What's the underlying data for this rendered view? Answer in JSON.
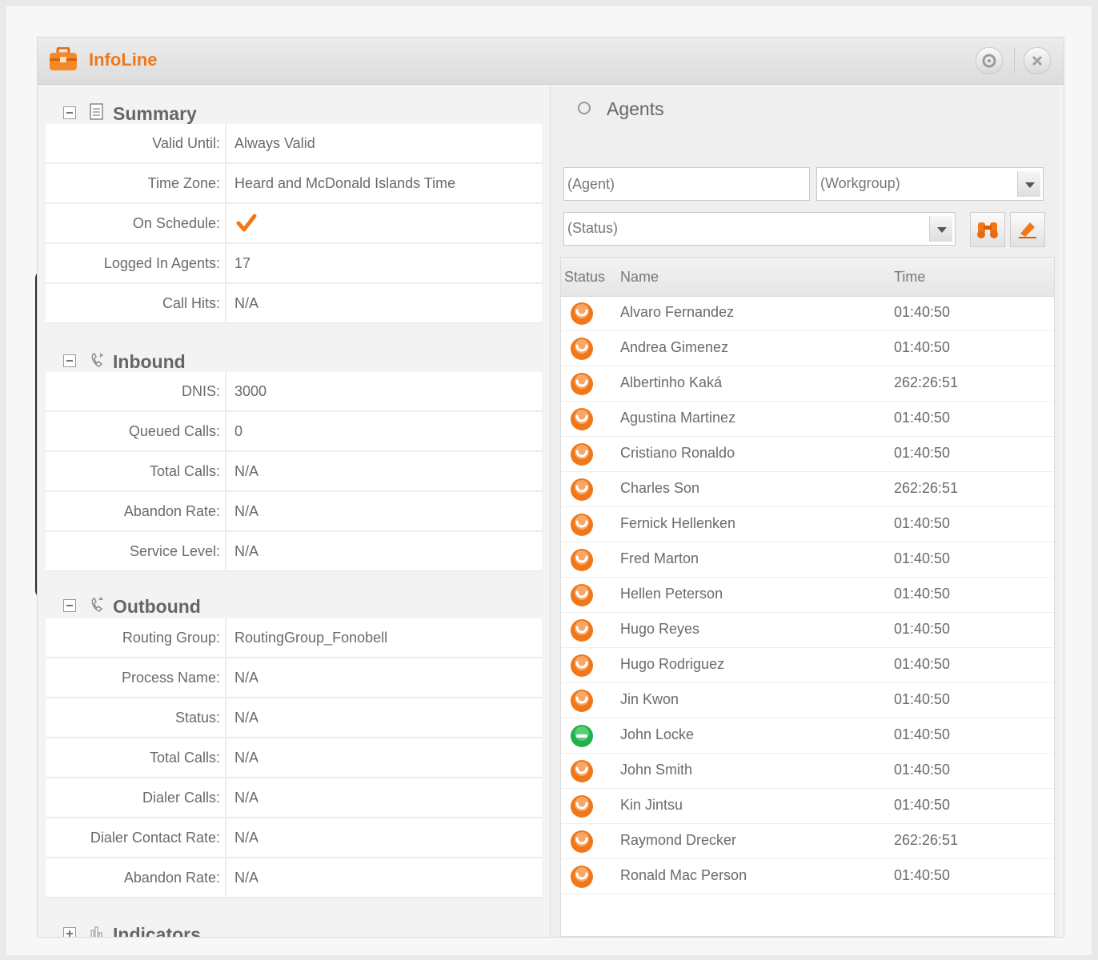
{
  "header": {
    "title": "InfoLine"
  },
  "summary": {
    "title": "Summary",
    "rows": [
      {
        "label": "Valid Until:",
        "value": "Always Valid"
      },
      {
        "label": "Time Zone:",
        "value": "Heard and McDonald Islands Time"
      },
      {
        "label": "On Schedule:",
        "value": ""
      },
      {
        "label": "Logged In Agents:",
        "value": "17"
      },
      {
        "label": "Call Hits:",
        "value": "N/A"
      }
    ]
  },
  "inbound": {
    "title": "Inbound",
    "rows": [
      {
        "label": "DNIS:",
        "value": "3000"
      },
      {
        "label": "Queued Calls:",
        "value": "0"
      },
      {
        "label": "Total Calls:",
        "value": "N/A"
      },
      {
        "label": "Abandon Rate:",
        "value": "N/A"
      },
      {
        "label": "Service Level:",
        "value": "N/A"
      }
    ]
  },
  "outbound": {
    "title": "Outbound",
    "rows": [
      {
        "label": "Routing Group:",
        "value": "RoutingGroup_Fonobell"
      },
      {
        "label": "Process Name:",
        "value": "N/A"
      },
      {
        "label": "Status:",
        "value": "N/A"
      },
      {
        "label": "Total Calls:",
        "value": "N/A"
      },
      {
        "label": "Dialer Calls:",
        "value": "N/A"
      },
      {
        "label": "Dialer Contact Rate:",
        "value": "N/A"
      },
      {
        "label": "Abandon Rate:",
        "value": "N/A"
      }
    ]
  },
  "indicators": {
    "title": "Indicators"
  },
  "agents": {
    "title": "Agents",
    "agent_filter": "(Agent)",
    "workgroup_filter": "(Workgroup)",
    "status_filter": "(Status)",
    "columns": {
      "status": "Status",
      "name": "Name",
      "time": "Time"
    },
    "rows": [
      {
        "name": "Alvaro Fernandez",
        "time": "01:40:50",
        "status": "orange"
      },
      {
        "name": "Andrea Gimenez",
        "time": "01:40:50",
        "status": "orange"
      },
      {
        "name": "Albertinho Kaká",
        "time": "262:26:51",
        "status": "orange"
      },
      {
        "name": "Agustina Martinez",
        "time": "01:40:50",
        "status": "orange"
      },
      {
        "name": "Cristiano Ronaldo",
        "time": "01:40:50",
        "status": "orange"
      },
      {
        "name": "Charles Son",
        "time": "262:26:51",
        "status": "orange"
      },
      {
        "name": "Fernick Hellenken",
        "time": "01:40:50",
        "status": "orange"
      },
      {
        "name": "Fred Marton",
        "time": "01:40:50",
        "status": "orange"
      },
      {
        "name": "Hellen Peterson",
        "time": "01:40:50",
        "status": "orange"
      },
      {
        "name": "Hugo Reyes",
        "time": "01:40:50",
        "status": "orange"
      },
      {
        "name": "Hugo Rodriguez",
        "time": "01:40:50",
        "status": "orange"
      },
      {
        "name": "Jin Kwon",
        "time": "01:40:50",
        "status": "orange"
      },
      {
        "name": "John Locke",
        "time": "01:40:50",
        "status": "green"
      },
      {
        "name": "John Smith",
        "time": "01:40:50",
        "status": "orange"
      },
      {
        "name": "Kin Jintsu",
        "time": "01:40:50",
        "status": "orange"
      },
      {
        "name": "Raymond Drecker",
        "time": "262:26:51",
        "status": "orange"
      },
      {
        "name": "Ronald Mac Person",
        "time": "01:40:50",
        "status": "orange"
      }
    ]
  },
  "colors": {
    "accent": "#f0781a",
    "available": "#22b14c"
  },
  "icons": {
    "title": "briefcase-icon",
    "on_schedule": "check-icon",
    "search": "binoculars-icon",
    "clear": "eraser-icon",
    "summary": "document-icon",
    "inbound": "inbound-phone-icon",
    "outbound": "outbound-phone-icon",
    "indicators": "bar-chart-icon"
  }
}
